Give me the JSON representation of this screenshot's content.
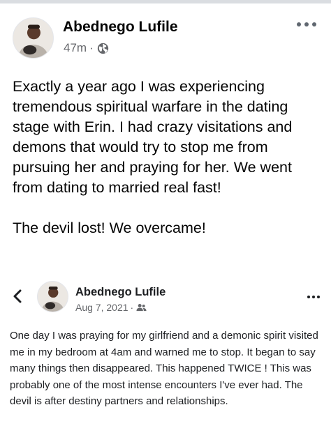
{
  "post": {
    "author": "Abednego Lufile",
    "time": "47m",
    "separator": "·",
    "privacy_icon": "globe-icon",
    "menu_icon": "more-options-icon",
    "paragraphs": [
      "Exactly a year ago I was experiencing tremendous spiritual warfare in the dating stage with Erin. I had crazy visitations and demons that would try to stop me from pursuing her and praying for her. We went from dating to married real fast!",
      "The devil lost! We overcame!"
    ]
  },
  "shared_post": {
    "back_icon": "chevron-left-icon",
    "author": "Abednego Lufile",
    "date": "Aug 7, 2021",
    "separator": "·",
    "privacy_icon": "friends-icon",
    "menu_icon": "more-options-icon",
    "text": "One day I was praying for my girlfriend and a demonic spirit visited me in my bedroom at 4am and warned me to stop. It began to say many things then disappeared. This happened TWICE ! This was probably one of the most intense encounters I've ever had. The devil is after destiny partners and relationships."
  },
  "colors": {
    "text": "#050505",
    "secondary": "#65676b",
    "divider": "#dadde1"
  }
}
